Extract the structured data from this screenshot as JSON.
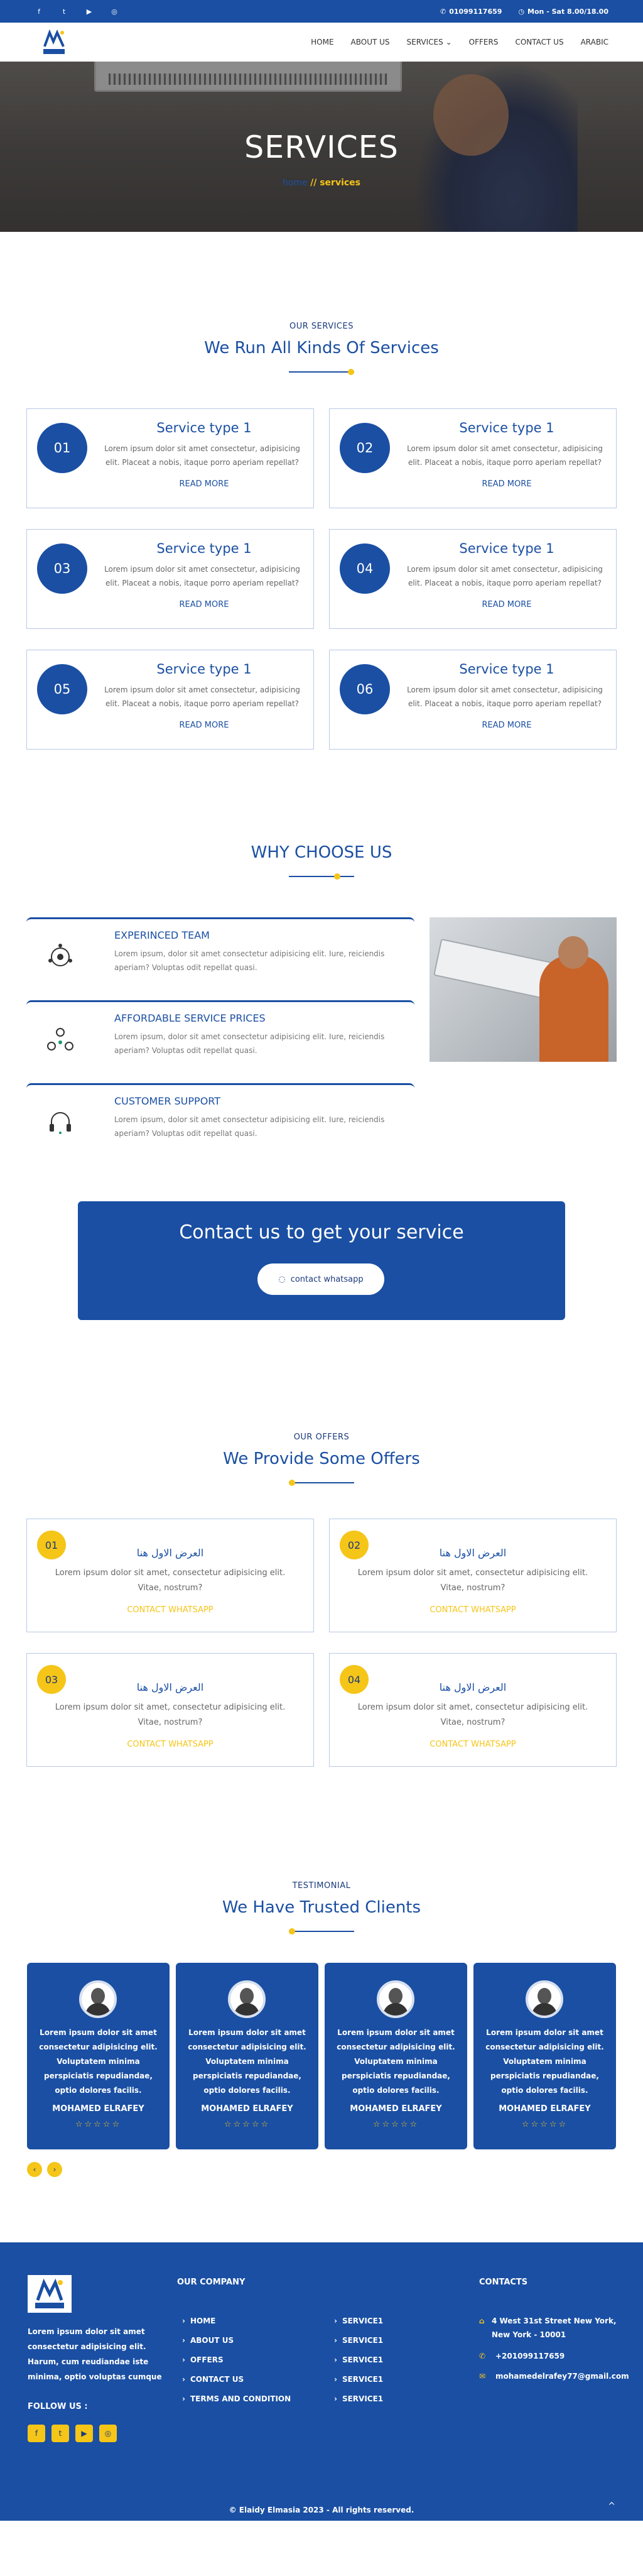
{
  "topbar": {
    "socials": [
      "facebook-icon",
      "twitter-icon",
      "youtube-icon",
      "instagram-icon"
    ],
    "social_glyphs": [
      "f",
      "t",
      "▶",
      "◎"
    ],
    "phone": "01099117659",
    "hours": "Mon - Sat 8.00/18.00"
  },
  "nav": {
    "items": [
      "HOME",
      "ABOUT US",
      "SERVICES",
      "OFFERS",
      "CONTACT US",
      "ARABIC"
    ]
  },
  "hero": {
    "title": "SERVICES",
    "crumb_home": "home",
    "crumb_current": "// services"
  },
  "services": {
    "subtitle": "OUR SERVICES",
    "title": "We Run All Kinds Of Services",
    "cards": [
      {
        "num": "01",
        "title": "Service type 1",
        "desc": "Lorem ipsum dolor sit amet consectetur, adipisicing elit. Placeat a nobis, itaque porro aperiam repellat?",
        "more": "READ MORE"
      },
      {
        "num": "02",
        "title": "Service type 1",
        "desc": "Lorem ipsum dolor sit amet consectetur, adipisicing elit. Placeat a nobis, itaque porro aperiam repellat?",
        "more": "READ MORE"
      },
      {
        "num": "03",
        "title": "Service type 1",
        "desc": "Lorem ipsum dolor sit amet consectetur, adipisicing elit. Placeat a nobis, itaque porro aperiam repellat?",
        "more": "READ MORE"
      },
      {
        "num": "04",
        "title": "Service type 1",
        "desc": "Lorem ipsum dolor sit amet consectetur, adipisicing elit. Placeat a nobis, itaque porro aperiam repellat?",
        "more": "READ MORE"
      },
      {
        "num": "05",
        "title": "Service type 1",
        "desc": "Lorem ipsum dolor sit amet consectetur, adipisicing elit. Placeat a nobis, itaque porro aperiam repellat?",
        "more": "READ MORE"
      },
      {
        "num": "06",
        "title": "Service type 1",
        "desc": "Lorem ipsum dolor sit amet consectetur, adipisicing elit. Placeat a nobis, itaque porro aperiam repellat?",
        "more": "READ MORE"
      }
    ]
  },
  "why": {
    "title": "WHY CHOOSE US",
    "items": [
      {
        "title": "EXPERINCED TEAM",
        "desc": "Lorem ipsum, dolor sit amet consectetur adipisicing elit. Iure, reiciendis aperiam? Voluptas odit repellat quasi."
      },
      {
        "title": "AFFORDABLE SERVICE PRICES",
        "desc": "Lorem ipsum, dolor sit amet consectetur adipisicing elit. Iure, reiciendis aperiam? Voluptas odit repellat quasi."
      },
      {
        "title": "CUSTOMER SUPPORT",
        "desc": "Lorem ipsum, dolor sit amet consectetur adipisicing elit. Iure, reiciendis aperiam? Voluptas odit repellat quasi."
      }
    ]
  },
  "contact": {
    "title": "Contact us to get your service",
    "button": "contact whatsapp"
  },
  "offers": {
    "subtitle": "OUR OFFERS",
    "title": "We Provide Some Offers",
    "cards": [
      {
        "num": "01",
        "title": "العرض الاول هنا",
        "desc": "Lorem ipsum dolor sit amet, consectetur adipisicing elit. Vitae, nostrum?",
        "link": "CONTACT WHATSAPP"
      },
      {
        "num": "02",
        "title": "العرض الاول هنا",
        "desc": "Lorem ipsum dolor sit amet, consectetur adipisicing elit. Vitae, nostrum?",
        "link": "CONTACT WHATSAPP"
      },
      {
        "num": "03",
        "title": "العرض الاول هنا",
        "desc": "Lorem ipsum dolor sit amet, consectetur adipisicing elit. Vitae, nostrum?",
        "link": "CONTACT WHATSAPP"
      },
      {
        "num": "04",
        "title": "العرض الاول هنا",
        "desc": "Lorem ipsum dolor sit amet, consectetur adipisicing elit. Vitae, nostrum?",
        "link": "CONTACT WHATSAPP"
      }
    ]
  },
  "testimonials": {
    "subtitle": "TESTIMONIAL",
    "title": "We Have Trusted Clients",
    "cards": [
      {
        "text": "Lorem ipsum dolor sit amet consectetur adipisicing elit. Voluptatem minima perspiciatis repudiandae, optio dolores facilis.",
        "name": "MOHAMED ELRAFEY",
        "stars": "☆☆☆☆☆"
      },
      {
        "text": "Lorem ipsum dolor sit amet consectetur adipisicing elit. Voluptatem minima perspiciatis repudiandae, optio dolores facilis.",
        "name": "MOHAMED ELRAFEY",
        "stars": "☆☆☆☆☆"
      },
      {
        "text": "Lorem ipsum dolor sit amet consectetur adipisicing elit. Voluptatem minima perspiciatis repudiandae, optio dolores facilis.",
        "name": "MOHAMED ELRAFEY",
        "stars": "☆☆☆☆☆"
      },
      {
        "text": "Lorem ipsum dolor sit amet consectetur adipisicing elit. Voluptatem minima perspiciatis repudiandae, optio dolores facilis.",
        "name": "MOHAMED ELRAFEY",
        "stars": "☆☆☆☆☆"
      }
    ],
    "prev": "‹",
    "next": "›"
  },
  "footer": {
    "about": "Lorem ipsum dolor sit amet consectetur adipisicing elit. Harum, cum reudiandae iste minima, optio voluptas cumque",
    "follow": "FOLLOW US :",
    "social_glyphs": [
      "f",
      "t",
      "▶",
      "◎"
    ],
    "company_title": "OUR COMPANY",
    "company_links": [
      "HOME",
      "ABOUT US",
      "OFFERS",
      "CONTACT US",
      "TERMS AND CONDITION"
    ],
    "service_links": [
      "SERVICE1",
      "SERVICE1",
      "SERVICE1",
      "SERVICE1",
      "SERVICE1"
    ],
    "contacts_title": "CONTACTS",
    "address": "4 West 31st Street New York, New York - 10001",
    "phone": "+201099117659",
    "email": "mohamedelrafey77@gmail.com",
    "copyright": "© Elaidy Elmasia 2023 - All rights reserved.",
    "up": "^"
  },
  "colors": {
    "primary": "#1a4fa3",
    "accent": "#f5c518"
  }
}
